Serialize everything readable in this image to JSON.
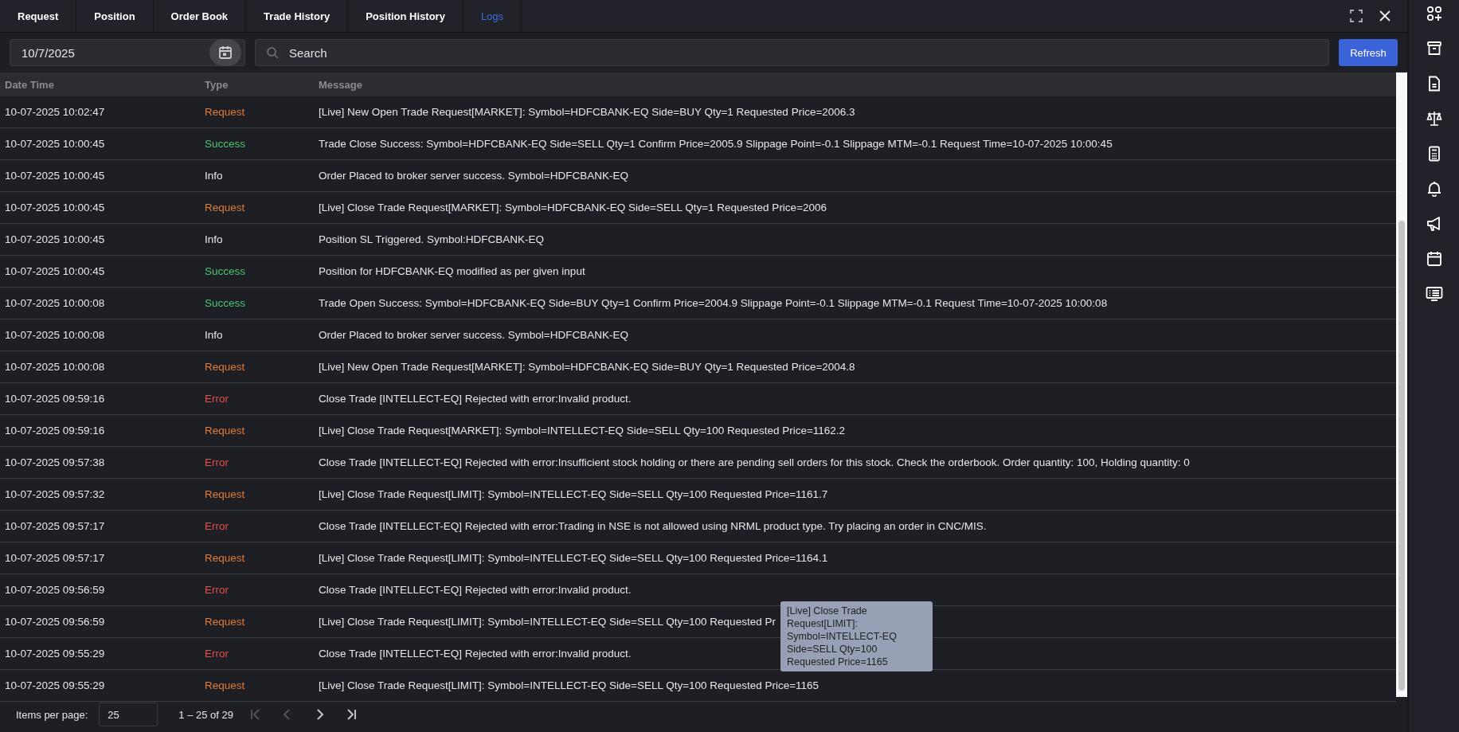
{
  "tabs": [
    {
      "label": "Request",
      "selected": false
    },
    {
      "label": "Position",
      "selected": false
    },
    {
      "label": "Order Book",
      "selected": false
    },
    {
      "label": "Trade History",
      "selected": false
    },
    {
      "label": "Position History",
      "selected": false
    },
    {
      "label": "Logs",
      "selected": true
    }
  ],
  "toolbar": {
    "date": "10/7/2025",
    "search": {
      "placeholder": "Search"
    },
    "refresh": "Refresh"
  },
  "table": {
    "columns": [
      "Date Time",
      "Type",
      "Message"
    ],
    "rows": [
      {
        "time": "10-07-2025 10:02:47",
        "type": "Request",
        "kind": "request",
        "message": "[Live] New Open Trade Request[MARKET]: Symbol=HDFCBANK-EQ Side=BUY Qty=1 Requested Price=2006.3"
      },
      {
        "time": "10-07-2025 10:00:45",
        "type": "Success",
        "kind": "success",
        "message": "Trade Close Success: Symbol=HDFCBANK-EQ Side=SELL Qty=1 Confirm Price=2005.9 Slippage Point=-0.1 Slippage MTM=-0.1 Request Time=10-07-2025 10:00:45"
      },
      {
        "time": "10-07-2025 10:00:45",
        "type": "Info",
        "kind": "info",
        "message": "Order Placed to broker server success. Symbol=HDFCBANK-EQ"
      },
      {
        "time": "10-07-2025 10:00:45",
        "type": "Request",
        "kind": "request",
        "message": "[Live] Close Trade Request[MARKET]: Symbol=HDFCBANK-EQ Side=SELL Qty=1 Requested Price=2006"
      },
      {
        "time": "10-07-2025 10:00:45",
        "type": "Info",
        "kind": "info",
        "message": "Position SL Triggered. Symbol:HDFCBANK-EQ"
      },
      {
        "time": "10-07-2025 10:00:45",
        "type": "Success",
        "kind": "success",
        "message": "Position for HDFCBANK-EQ modified as per given input"
      },
      {
        "time": "10-07-2025 10:00:08",
        "type": "Success",
        "kind": "success",
        "message": "Trade Open Success: Symbol=HDFCBANK-EQ Side=BUY Qty=1 Confirm Price=2004.9 Slippage Point=-0.1 Slippage MTM=-0.1 Request Time=10-07-2025 10:00:08"
      },
      {
        "time": "10-07-2025 10:00:08",
        "type": "Info",
        "kind": "info",
        "message": "Order Placed to broker server success. Symbol=HDFCBANK-EQ"
      },
      {
        "time": "10-07-2025 10:00:08",
        "type": "Request",
        "kind": "request",
        "message": "[Live] New Open Trade Request[MARKET]: Symbol=HDFCBANK-EQ Side=BUY Qty=1 Requested Price=2004.8"
      },
      {
        "time": "10-07-2025 09:59:16",
        "type": "Error",
        "kind": "error",
        "message": "Close Trade [INTELLECT-EQ] Rejected with error:Invalid product."
      },
      {
        "time": "10-07-2025 09:59:16",
        "type": "Request",
        "kind": "request",
        "message": "[Live] Close Trade Request[MARKET]: Symbol=INTELLECT-EQ Side=SELL Qty=100 Requested Price=1162.2"
      },
      {
        "time": "10-07-2025 09:57:38",
        "type": "Error",
        "kind": "error",
        "message": "Close Trade [INTELLECT-EQ] Rejected with error:Insufficient stock holding or there are pending sell orders for this stock. Check the orderbook. Order quantity: 100, Holding quantity: 0"
      },
      {
        "time": "10-07-2025 09:57:32",
        "type": "Request",
        "kind": "request",
        "message": "[Live] Close Trade Request[LIMIT]: Symbol=INTELLECT-EQ Side=SELL Qty=100 Requested Price=1161.7"
      },
      {
        "time": "10-07-2025 09:57:17",
        "type": "Error",
        "kind": "error",
        "message": "Close Trade [INTELLECT-EQ] Rejected with error:Trading in NSE is not allowed using NRML product type. Try placing an order in CNC/MIS."
      },
      {
        "time": "10-07-2025 09:57:17",
        "type": "Request",
        "kind": "request",
        "message": "[Live] Close Trade Request[LIMIT]: Symbol=INTELLECT-EQ Side=SELL Qty=100 Requested Price=1164.1"
      },
      {
        "time": "10-07-2025 09:56:59",
        "type": "Error",
        "kind": "error",
        "message": "Close Trade [INTELLECT-EQ] Rejected with error:Invalid product."
      },
      {
        "time": "10-07-2025 09:56:59",
        "type": "Request",
        "kind": "request",
        "message": "[Live] Close Trade Request[LIMIT]: Symbol=INTELLECT-EQ Side=SELL Qty=100 Requested Pr",
        "tooltip": "[Live] Close Trade Request[LIMIT]: Symbol=INTELLECT-EQ Side=SELL Qty=100 Requested Price=1165"
      },
      {
        "time": "10-07-2025 09:55:29",
        "type": "Error",
        "kind": "error",
        "message": "Close Trade [INTELLECT-EQ] Rejected with error:Invalid product."
      },
      {
        "time": "10-07-2025 09:55:29",
        "type": "Request",
        "kind": "request",
        "message": "[Live] Close Trade Request[LIMIT]: Symbol=INTELLECT-EQ Side=SELL Qty=100 Requested Price=1165"
      }
    ]
  },
  "pagination": {
    "label": "Items per page:",
    "page_size": "25",
    "range": "1 – 25 of 29",
    "first_disabled": true,
    "previous_disabled": true,
    "next_disabled": false,
    "last_disabled": false
  }
}
